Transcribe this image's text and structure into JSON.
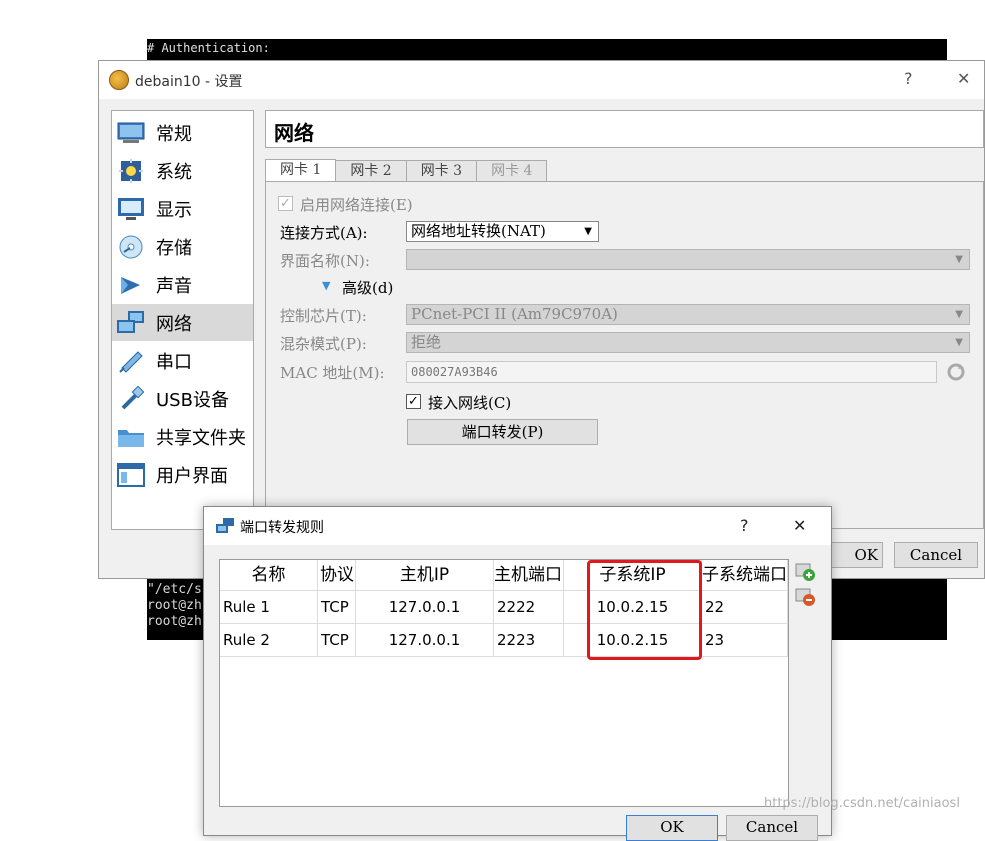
{
  "background_terminal": {
    "top_line": "# Authentication:",
    "bottom_lines": [
      "\"/etc/s",
      "root@zh",
      "root@zh"
    ]
  },
  "settings_window": {
    "title": "debain10 - 设置",
    "help_symbol": "?",
    "close_symbol": "✕",
    "sidebar": [
      {
        "label": "常规",
        "icon": "general-icon"
      },
      {
        "label": "系统",
        "icon": "system-icon"
      },
      {
        "label": "显示",
        "icon": "display-icon"
      },
      {
        "label": "存储",
        "icon": "storage-icon"
      },
      {
        "label": "声音",
        "icon": "audio-icon"
      },
      {
        "label": "网络",
        "icon": "network-icon",
        "selected": true
      },
      {
        "label": "串口",
        "icon": "serial-icon"
      },
      {
        "label": "USB设备",
        "icon": "usb-icon"
      },
      {
        "label": "共享文件夹",
        "icon": "shared-folder-icon"
      },
      {
        "label": "用户界面",
        "icon": "user-interface-icon"
      }
    ],
    "page_title": "网络",
    "tabs": [
      "网卡 1",
      "网卡 2",
      "网卡 3",
      "网卡 4"
    ],
    "active_tab": "网卡 1",
    "enable_adapter": {
      "label": "启用网络连接(E)",
      "checked": true
    },
    "attached_to": {
      "label": "连接方式(A):",
      "value": "网络地址转换(NAT)"
    },
    "interface_name": {
      "label": "界面名称(N):",
      "value": ""
    },
    "advanced": {
      "label": "高级(d)"
    },
    "adapter_type": {
      "label": "控制芯片(T):",
      "value": "PCnet-PCI II (Am79C970A)"
    },
    "promiscuous": {
      "label": "混杂模式(P):",
      "value": "拒绝"
    },
    "mac": {
      "label": "MAC 地址(M):",
      "value": "080027A93B46"
    },
    "cable": {
      "label": "接入网线(C)",
      "checked": true
    },
    "port_forward_button": "端口转发(P)",
    "ok_button": "OK",
    "cancel_button": "Cancel"
  },
  "port_forward_dialog": {
    "title": "端口转发规则",
    "help_symbol": "?",
    "close_symbol": "✕",
    "columns": [
      "名称",
      "协议",
      "主机IP",
      "主机端口",
      "子系统IP",
      "子系统端口"
    ],
    "rows": [
      [
        "Rule 1",
        "TCP",
        "127.0.0.1",
        "2222",
        "10.0.2.15",
        "22"
      ],
      [
        "Rule 2",
        "TCP",
        "127.0.0.1",
        "2223",
        "10.0.2.15",
        "23"
      ]
    ],
    "ok_button": "OK",
    "cancel_button": "Cancel",
    "highlight_color": "#e0191e"
  },
  "watermark": "https://blog.csdn.net/cainiaosl"
}
